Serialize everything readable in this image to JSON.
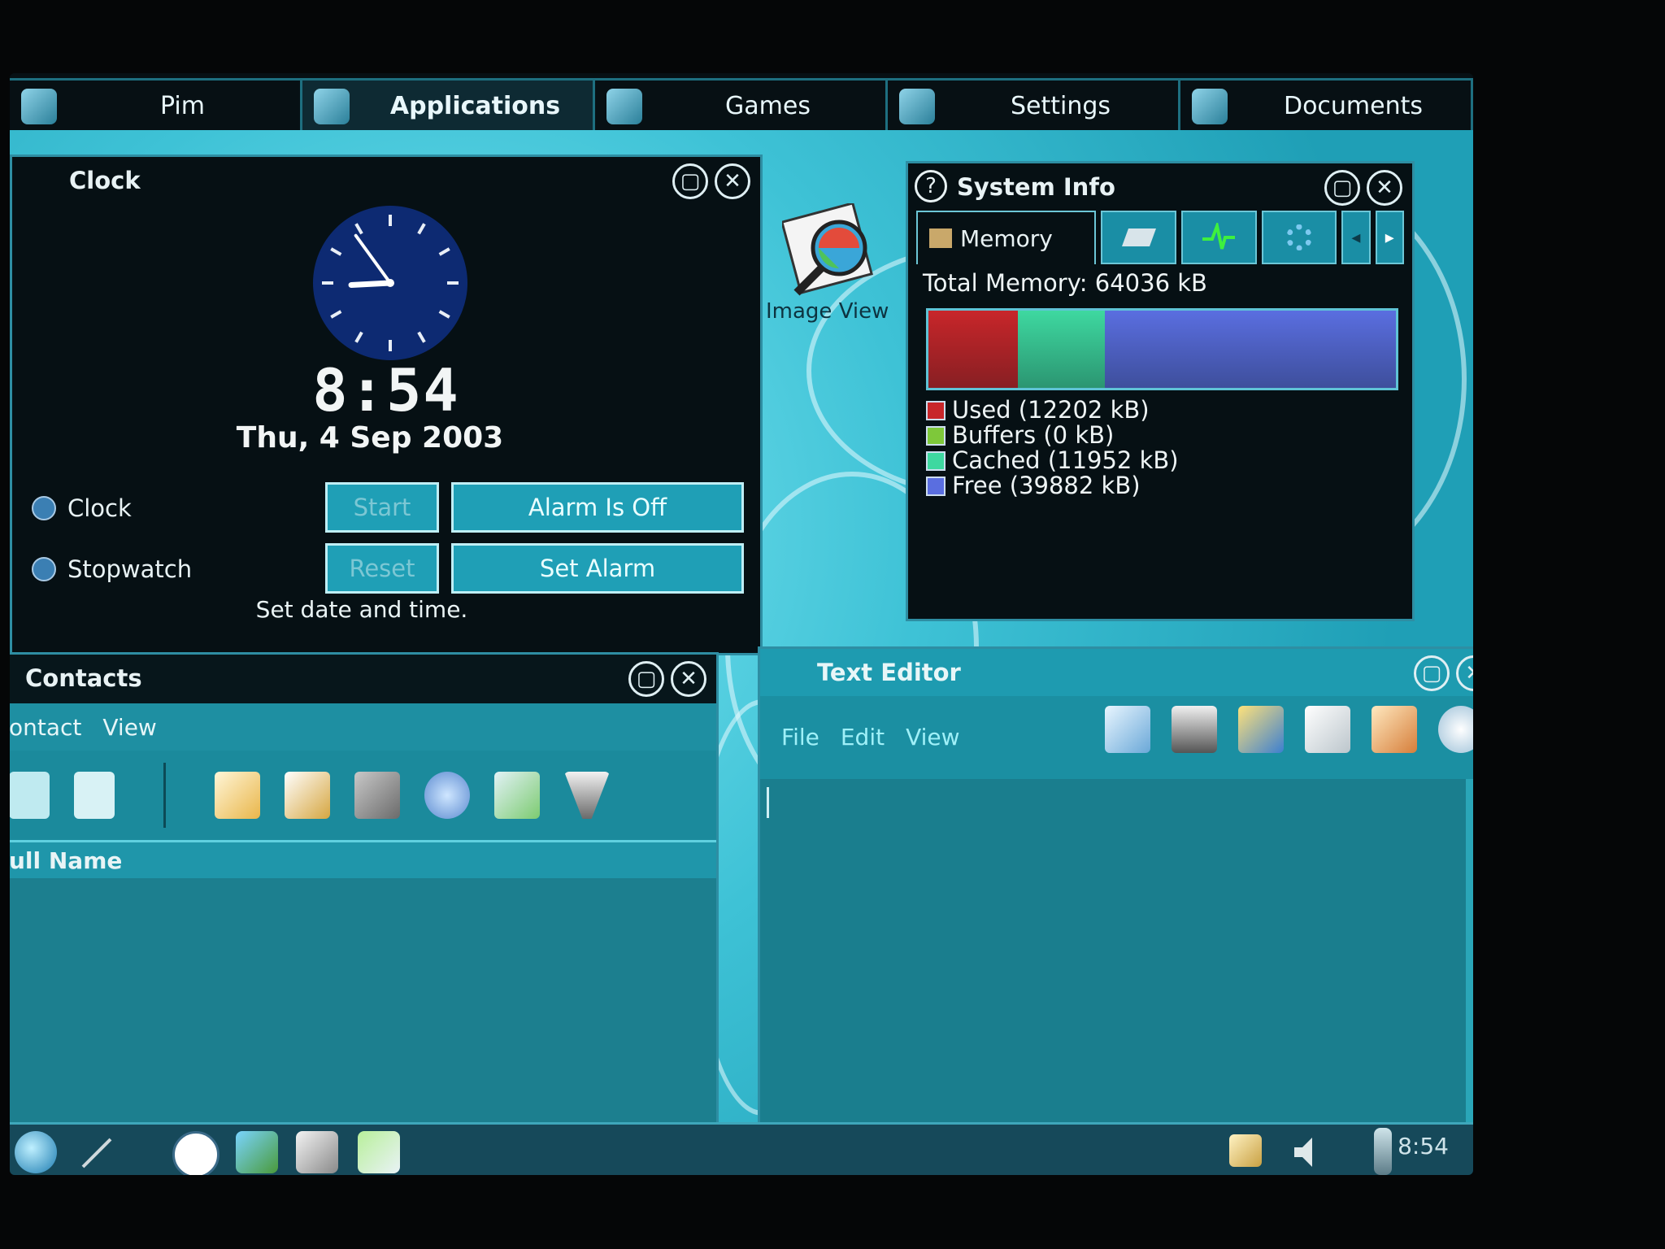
{
  "tabs": [
    {
      "label": "Pim",
      "icon": "pim-icon"
    },
    {
      "label": "Applications",
      "icon": "applications-icon",
      "active": true
    },
    {
      "label": "Games",
      "icon": "games-icon"
    },
    {
      "label": "Settings",
      "icon": "settings-icon"
    },
    {
      "label": "Documents",
      "icon": "documents-icon"
    }
  ],
  "desktop": {
    "image_viewer_label": "Image View"
  },
  "clock": {
    "title": "Clock",
    "time": "8:54",
    "date": "Thu,  4 Sep 2003",
    "mode_clock": "Clock",
    "mode_stopwatch": "Stopwatch",
    "start": "Start",
    "reset": "Reset",
    "alarm_status": "Alarm Is Off",
    "set_alarm": "Set Alarm",
    "hint": "Set date and time.",
    "hour": 8,
    "minute": 54
  },
  "sysinfo": {
    "title": "System Info",
    "tab_memory": "Memory",
    "total": "Total Memory: 64036 kB",
    "legend": [
      {
        "label": "Used (12202 kB)",
        "color": "#c8262a",
        "kb": 12202
      },
      {
        "label": "Buffers (0 kB)",
        "color": "#7ec83a",
        "kb": 0
      },
      {
        "label": "Cached (11952 kB)",
        "color": "#3ed8a0",
        "kb": 11952
      },
      {
        "label": "Free (39882 kB)",
        "color": "#5a6ee0",
        "kb": 39882
      }
    ]
  },
  "contacts": {
    "title": "Contacts",
    "menu_contact": "ontact",
    "menu_view": "View",
    "column": "ull Name"
  },
  "editor": {
    "title": "Text Editor",
    "menu_file": "File",
    "menu_edit": "Edit",
    "menu_view": "View"
  },
  "taskbar": {
    "clock": "8:54"
  },
  "colors": {
    "accent": "#1f9fb6",
    "window_bg": "#061014",
    "clock_face": "#0d2a72"
  }
}
